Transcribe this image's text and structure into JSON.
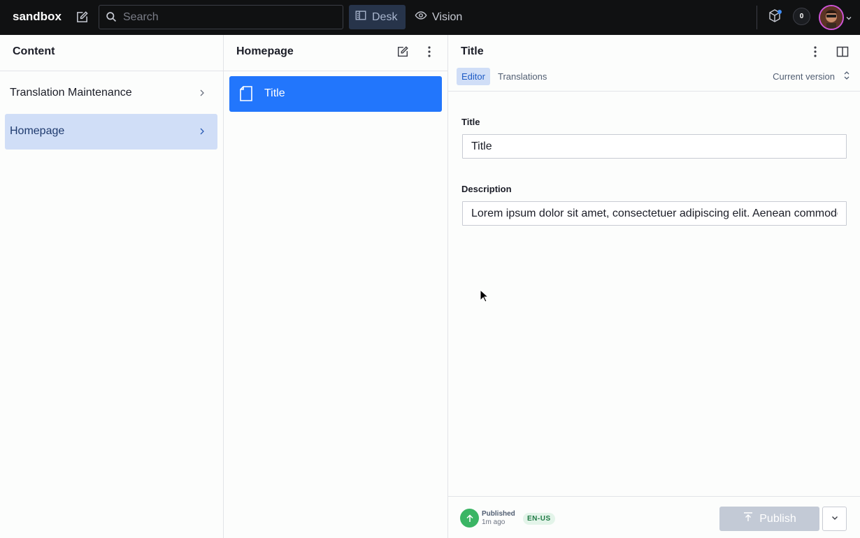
{
  "navbar": {
    "brand": "sandbox",
    "search_placeholder": "Search",
    "tools": [
      {
        "label": "Desk",
        "active": true
      },
      {
        "label": "Vision",
        "active": false
      }
    ],
    "notification_count": "0"
  },
  "structure_pane": {
    "title": "Content",
    "items": [
      {
        "label": "Translation Maintenance",
        "selected": false
      },
      {
        "label": "Homepage",
        "selected": true
      }
    ]
  },
  "list_pane": {
    "title": "Homepage",
    "documents": [
      {
        "label": "Title",
        "selected": true
      }
    ]
  },
  "editor_pane": {
    "title": "Title",
    "tabs": [
      {
        "label": "Editor",
        "active": true
      },
      {
        "label": "Translations",
        "active": false
      }
    ],
    "version_label": "Current version",
    "fields": {
      "title": {
        "label": "Title",
        "value": "Title"
      },
      "description": {
        "label": "Description",
        "value": "Lorem ipsum dolor sit amet, consectetuer adipiscing elit. Aenean commodo ligula eget dolor."
      }
    },
    "footer": {
      "status": "Published",
      "time": "1m ago",
      "locale": "EN-US",
      "publish_label": "Publish"
    }
  },
  "colors": {
    "navbar_bg": "#101112",
    "accent": "#2276fc",
    "selected_bg": "#d0def7",
    "published_green": "#3ab564"
  }
}
